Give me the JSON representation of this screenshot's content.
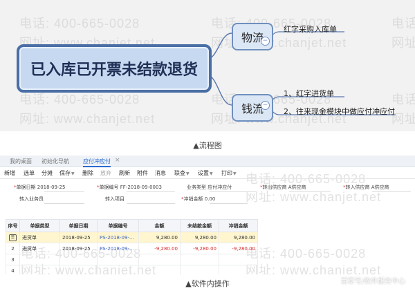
{
  "watermarks": {
    "phone": "电话: 400-665-0028",
    "site": "网址: www.chanjet.net",
    "short_phone": "电话",
    "short_site": "网址"
  },
  "mindmap": {
    "root": "已入库已开票未结款退货",
    "branches": [
      {
        "label": "物流",
        "leaves": [
          "红字采购入库单"
        ]
      },
      {
        "label": "钱流",
        "leaves": [
          "1、红字进货单",
          "2、往来现金模块中做应付冲应付"
        ]
      }
    ],
    "collapse_symbol": "−"
  },
  "captions": {
    "flow": "▲流程图",
    "software": "▲软件内操作"
  },
  "app": {
    "tabs": [
      {
        "label": "我的桌面",
        "active": false
      },
      {
        "label": "初始化导航",
        "active": false
      },
      {
        "label": "应付冲应付",
        "active": true
      }
    ],
    "tab_close": "×",
    "toolbar": [
      {
        "label": "新增",
        "dim": false,
        "dropdown": false
      },
      {
        "label": "选单",
        "dim": false,
        "dropdown": false
      },
      {
        "label": "分摊",
        "dim": false,
        "dropdown": false
      },
      {
        "label": "保存",
        "dim": false,
        "dropdown": true
      },
      {
        "label": "删除",
        "dim": false,
        "dropdown": false
      },
      {
        "label": "放弃",
        "dim": true,
        "dropdown": false
      },
      {
        "label": "刷新",
        "dim": false,
        "dropdown": false
      },
      {
        "label": "附件",
        "dim": false,
        "dropdown": false
      },
      {
        "label": "消息",
        "dim": false,
        "dropdown": false
      },
      {
        "label": "联查",
        "dim": false,
        "dropdown": true
      },
      {
        "label": "设置",
        "dim": false,
        "dropdown": true
      },
      {
        "label": "打印",
        "dim": false,
        "dropdown": true
      }
    ],
    "form": {
      "doc_date_label": "单据日期",
      "doc_date": "2018-09-25",
      "doc_no_label": "单据编号",
      "doc_no": "FF-2018-09-0003",
      "biz_type_label": "业务类型",
      "biz_type": "应付冲应付",
      "out_supplier_label": "转出供应商",
      "out_supplier": "A供应商",
      "in_supplier_label": "转入供应商",
      "in_supplier": "A供应商",
      "in_staff_label": "转入业务员",
      "in_staff": "",
      "in_project_label": "转入项目",
      "in_project": "",
      "offset_amount_label": "冲销金额",
      "offset_amount": "0.00",
      "required_mark": "*"
    },
    "table": {
      "headers": [
        "序号",
        "单据类型",
        "单据日期",
        "单据编号",
        "金额",
        "未结款金额",
        "冲销金额"
      ],
      "rows": [
        {
          "seq": "",
          "type": "进货单",
          "date": "2018-09-25",
          "no": "PS-2018-09-...",
          "amount": "9,280.00",
          "unsettled": "9,280.00",
          "offset": "9,280.00",
          "selected": true,
          "negative": false
        },
        {
          "seq": "2",
          "type": "进货单",
          "date": "2018-09-25",
          "no": "PS-2018-09-...",
          "amount": "-9,280.00",
          "unsettled": "-9,280.00",
          "offset": "-9,280.00",
          "selected": false,
          "negative": true
        },
        {
          "seq": "3",
          "type": "",
          "date": "",
          "no": "",
          "amount": "",
          "unsettled": "",
          "offset": "",
          "selected": false,
          "negative": false
        },
        {
          "seq": "4",
          "type": "",
          "date": "",
          "no": "",
          "amount": "",
          "unsettled": "",
          "offset": "",
          "selected": false,
          "negative": false
        }
      ]
    }
  },
  "footer_watermark": "百家号/软件服务中心"
}
